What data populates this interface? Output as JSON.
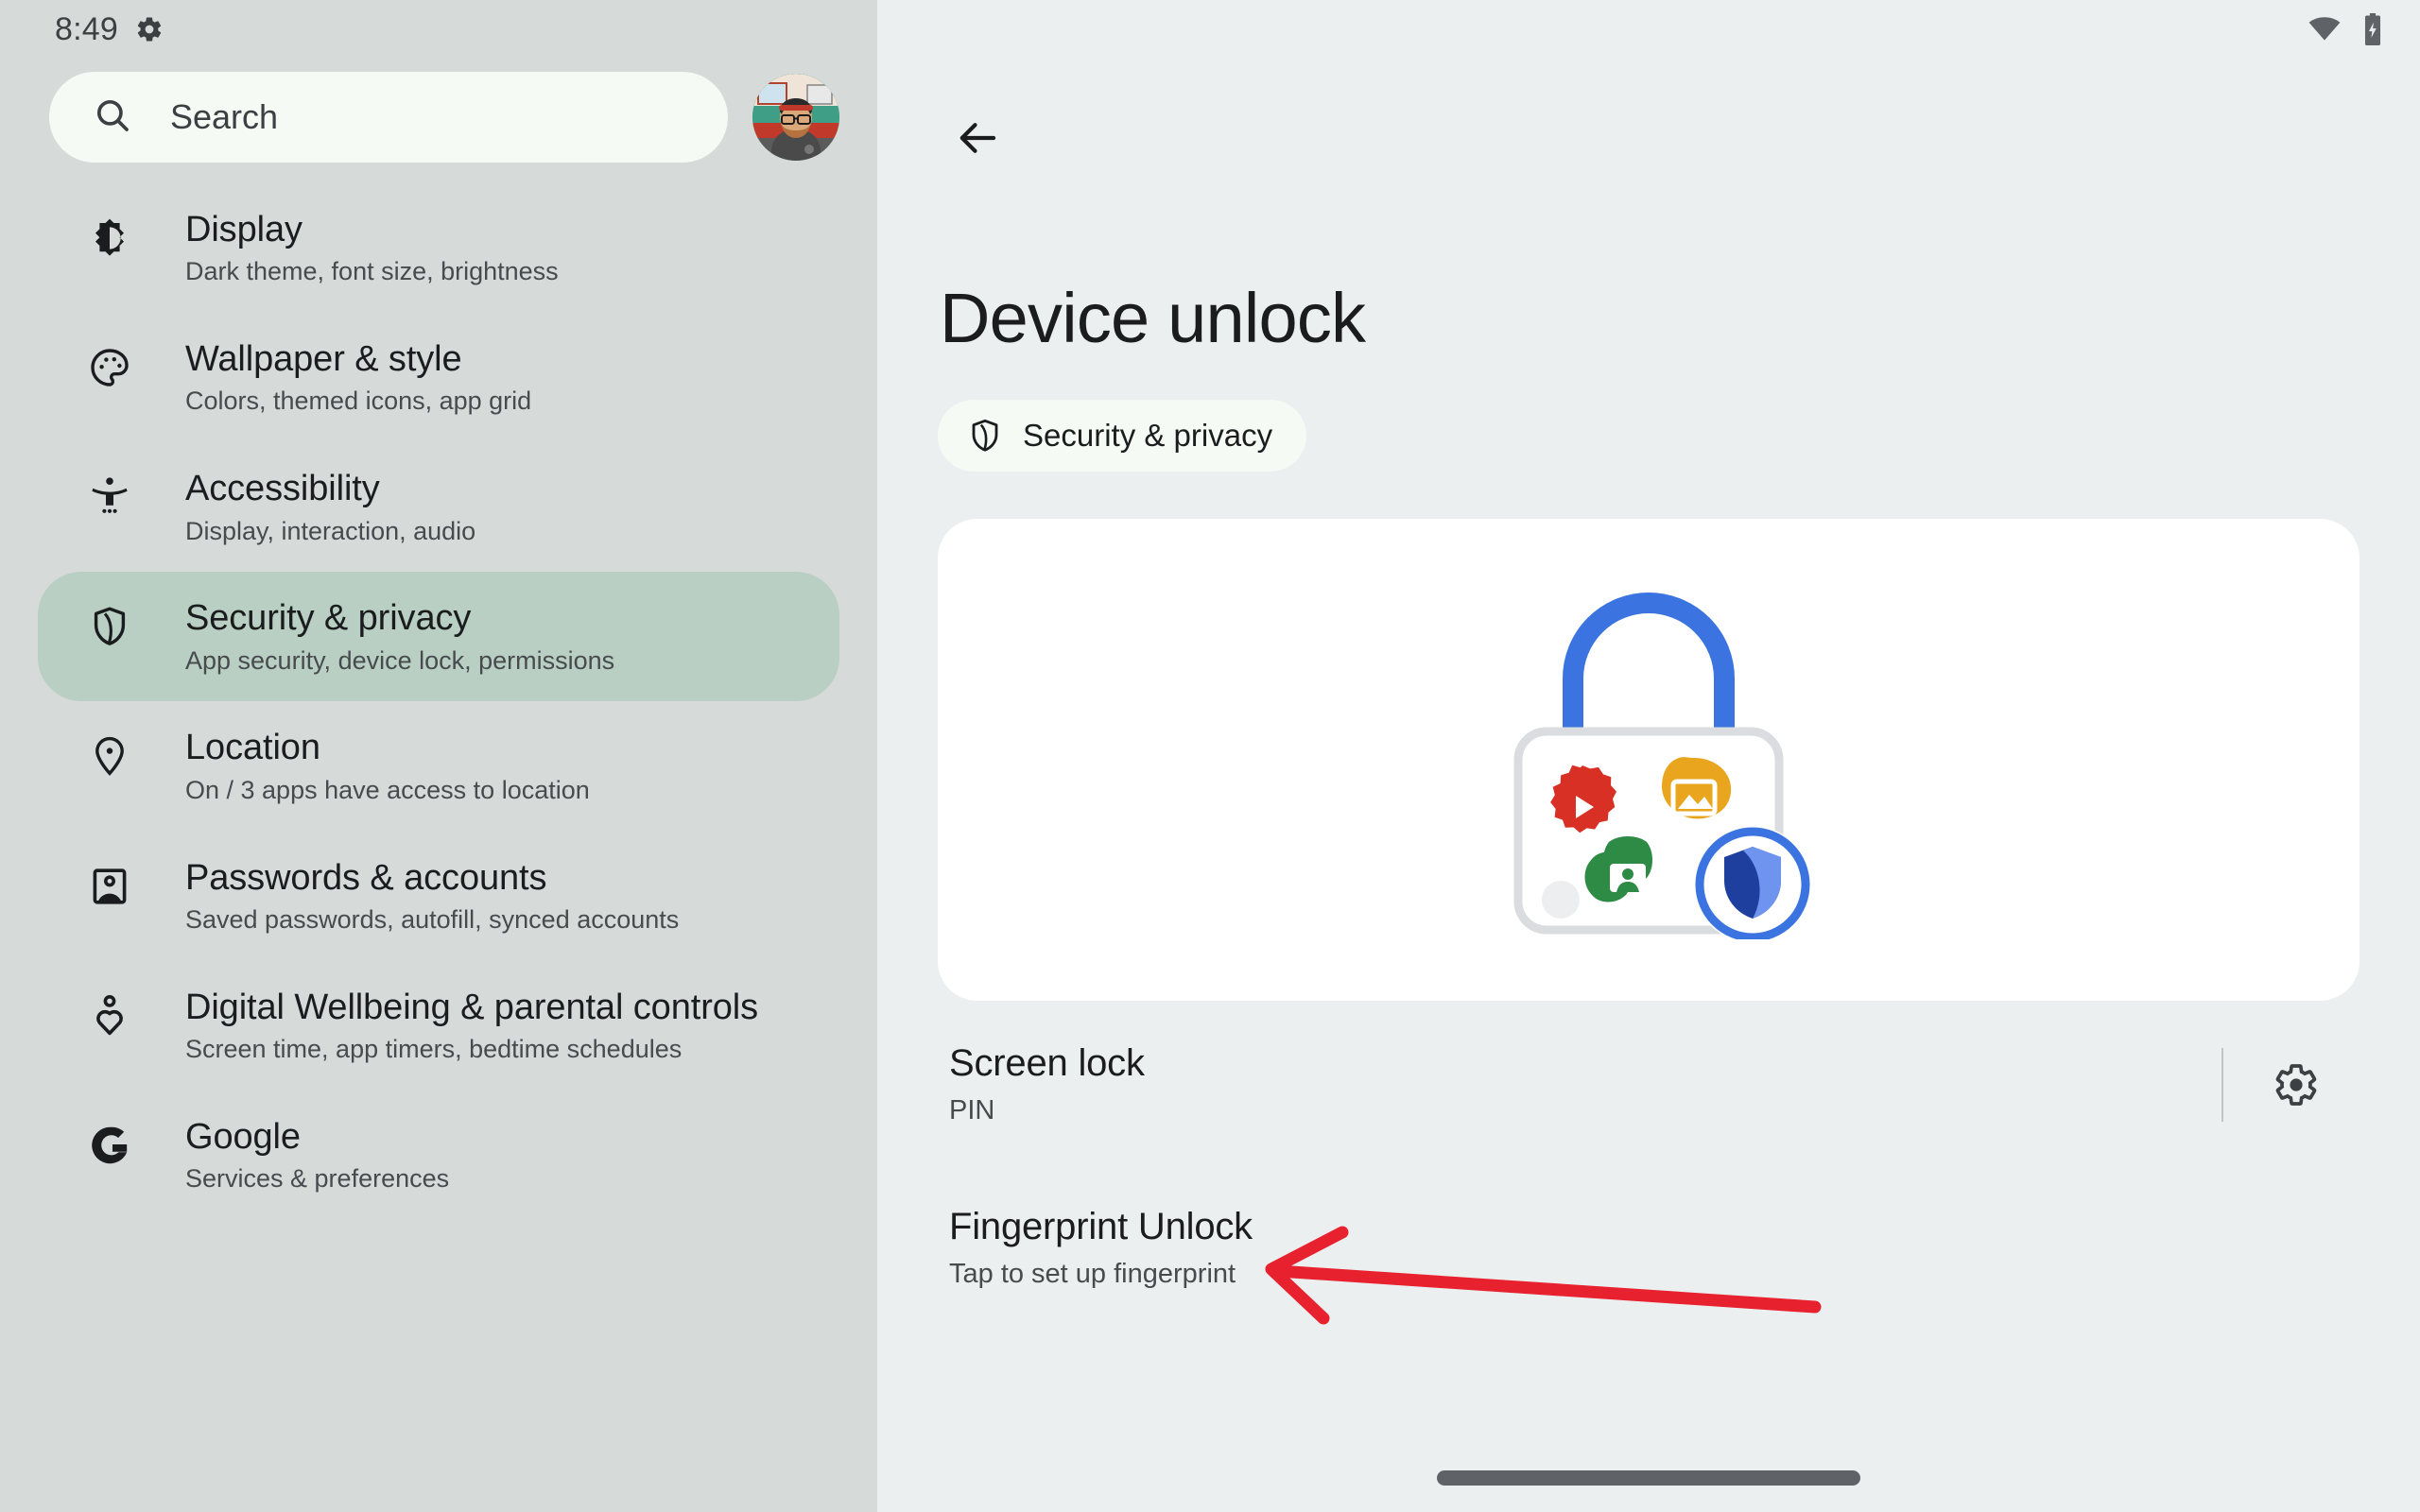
{
  "status_bar": {
    "time": "8:49",
    "settings_icon": "gear-icon",
    "wifi_icon": "wifi-icon",
    "battery_icon": "battery-charging-icon"
  },
  "sidebar": {
    "search": {
      "placeholder": "Search",
      "icon": "search-icon"
    },
    "avatar": {
      "name": "user-avatar"
    },
    "items": [
      {
        "id": "display",
        "icon": "brightness-icon",
        "title": "Display",
        "subtitle": "Dark theme, font size, brightness",
        "selected": false
      },
      {
        "id": "wallpaper-style",
        "icon": "palette-icon",
        "title": "Wallpaper & style",
        "subtitle": "Colors, themed icons, app grid",
        "selected": false
      },
      {
        "id": "accessibility",
        "icon": "accessibility-icon",
        "title": "Accessibility",
        "subtitle": "Display, interaction, audio",
        "selected": false
      },
      {
        "id": "security-privacy",
        "icon": "shield-icon",
        "title": "Security & privacy",
        "subtitle": "App security, device lock, permissions",
        "selected": true
      },
      {
        "id": "location",
        "icon": "location-pin-icon",
        "title": "Location",
        "subtitle": "On / 3 apps have access to location",
        "selected": false
      },
      {
        "id": "passwords-accounts",
        "icon": "id-card-icon",
        "title": "Passwords & accounts",
        "subtitle": "Saved passwords, autofill, synced accounts",
        "selected": false
      },
      {
        "id": "digital-wellbeing",
        "icon": "person-heart-icon",
        "title": "Digital Wellbeing & parental controls",
        "subtitle": "Screen time, app timers, bedtime schedules",
        "selected": false
      },
      {
        "id": "google",
        "icon": "google-g-icon",
        "title": "Google",
        "subtitle": "Services & preferences",
        "selected": false
      }
    ]
  },
  "main": {
    "back_icon": "arrow-left-icon",
    "title": "Device unlock",
    "breadcrumb_chip": {
      "label": "Security & privacy",
      "icon": "shield-icon"
    },
    "illustration": {
      "name": "padlock-apps-shield-illustration",
      "lock_color": "#3b74e0",
      "body_border_color": "#dadce0",
      "app_icons": [
        {
          "name": "play-badge-icon",
          "color": "#d93025"
        },
        {
          "name": "photos-image-icon",
          "color": "#eaa51f"
        },
        {
          "name": "contacts-person-icon",
          "color": "#2e8b45"
        }
      ],
      "shield_badge": {
        "ring_color": "#3b74e0",
        "dark_color": "#1f3f9e",
        "light_color": "#6e94f0"
      }
    },
    "rows": [
      {
        "id": "screen-lock",
        "title": "Screen lock",
        "subtitle": "PIN",
        "trailing_icon": "gear-icon",
        "has_divider": true
      },
      {
        "id": "fingerprint-unlock",
        "title": "Fingerprint Unlock",
        "subtitle": "Tap to set up fingerprint",
        "trailing_icon": "",
        "has_divider": false
      }
    ],
    "annotation": {
      "type": "arrow",
      "color": "#e8212f",
      "points_to": "Fingerprint Unlock"
    },
    "gesture_bar": "home-gesture-bar"
  }
}
